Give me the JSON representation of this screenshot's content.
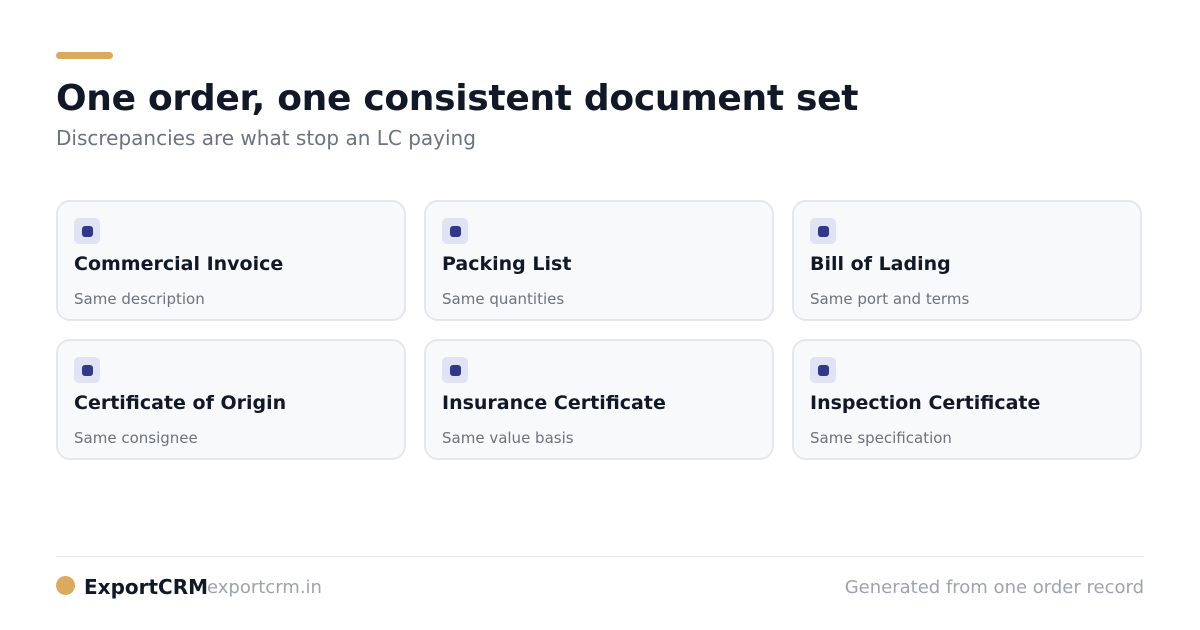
{
  "colors": {
    "accent": "#dcaa5f",
    "icon_badge_bg": "#dfe3f3",
    "icon_dot": "#2e3a87",
    "heading": "#111827",
    "muted": "#6b7280"
  },
  "header": {
    "title": "One order, one consistent document set",
    "subtitle": "Discrepancies are what stop an LC paying"
  },
  "cards": [
    {
      "title": "Commercial Invoice",
      "subtitle": "Same description",
      "icon": "document-icon"
    },
    {
      "title": "Packing List",
      "subtitle": "Same quantities",
      "icon": "document-icon"
    },
    {
      "title": "Bill of Lading",
      "subtitle": "Same port and terms",
      "icon": "document-icon"
    },
    {
      "title": "Certificate of Origin",
      "subtitle": "Same consignee",
      "icon": "document-icon"
    },
    {
      "title": "Insurance Certificate",
      "subtitle": "Same value basis",
      "icon": "document-icon"
    },
    {
      "title": "Inspection Certificate",
      "subtitle": "Same specification",
      "icon": "document-icon"
    }
  ],
  "footer": {
    "brand": "ExportCRM",
    "url": "exportcrm.in",
    "note": "Generated from one order record"
  }
}
